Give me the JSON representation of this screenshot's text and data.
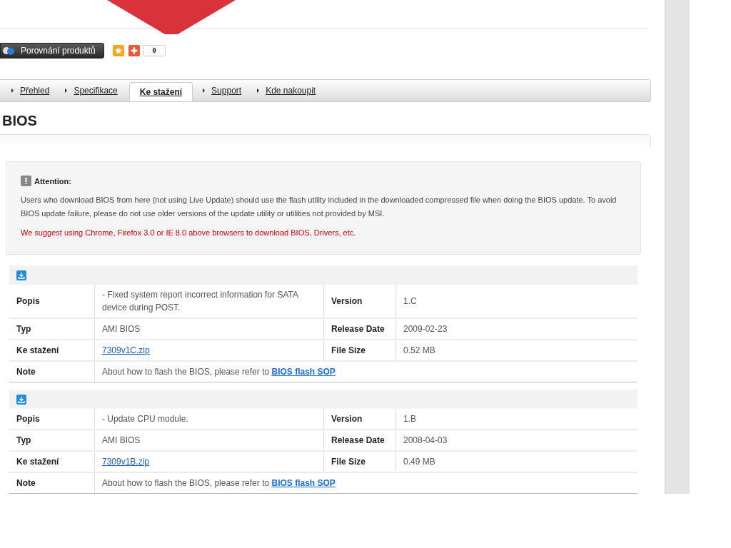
{
  "compare_button": {
    "label": "Porovnání produktů"
  },
  "share": {
    "count": "0"
  },
  "tabs": [
    {
      "label": "Přehled",
      "selected": false
    },
    {
      "label": "Specifikace",
      "selected": false
    },
    {
      "label": "Ke stažení",
      "selected": true
    },
    {
      "label": "Support",
      "selected": false
    },
    {
      "label": "Kde nakoupit",
      "selected": false
    }
  ],
  "heading": "BIOS",
  "attention": {
    "title": "Attention:",
    "text": "Users who download BIOS from here (not using Live Update) should use the flash utility included in the downloaded compressed file when doing the BIOS update. To avoid BIOS update failure, please do not use older versions of the update utility or utilities not provided by MSI.",
    "warning": "We suggest using Chrome, Firefox 3.0 or IE 8.0 above browsers to download BIOS, Drivers, etc."
  },
  "downloads": [
    {
      "rows": [
        {
          "label": "Popis",
          "value": "- Fixed system report incorrect information for SATA device during POST.",
          "label_2": "Version",
          "value_2": "1.C"
        },
        {
          "label": "Typ",
          "value": "AMI BIOS",
          "label_2": "Release Date",
          "value_2": "2009-02-23"
        },
        {
          "label": "Ke stažení",
          "link": "7309v1C.zip",
          "label_2": "File Size",
          "value_2": "0.52 MB"
        }
      ],
      "note": {
        "label": "Note",
        "text": "About how to flash the BIOS, please refer to ",
        "link": "BIOS flash SOP"
      }
    },
    {
      "rows": [
        {
          "label": "Popis",
          "value": "- Update CPU module.",
          "label_2": "Version",
          "value_2": "1.B"
        },
        {
          "label": "Typ",
          "value": "AMI BIOS",
          "label_2": "Release Date",
          "value_2": "2008-04-03"
        },
        {
          "label": "Ke stažení",
          "link": "7309v1B.zip",
          "label_2": "File Size",
          "value_2": "0.49 MB"
        }
      ],
      "note": {
        "label": "Note",
        "text": "About how to flash the BIOS, please refer to ",
        "link": "BIOS flash SOP"
      }
    }
  ]
}
